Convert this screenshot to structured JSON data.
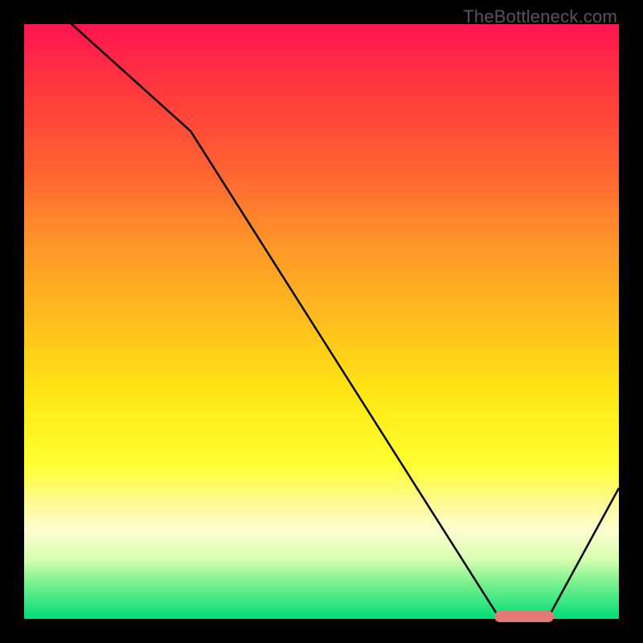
{
  "watermark": "TheBottleneck.com",
  "chart_data": {
    "type": "line",
    "title": "",
    "xlabel": "",
    "ylabel": "",
    "xlim": [
      0,
      100
    ],
    "ylim": [
      0,
      100
    ],
    "x": [
      0,
      8,
      28,
      80,
      88,
      100
    ],
    "values": [
      110,
      100,
      82,
      0,
      0,
      22
    ],
    "gradient_stops": [
      {
        "pct": 0,
        "color": "#ff1450"
      },
      {
        "pct": 25,
        "color": "#ff6432"
      },
      {
        "pct": 50,
        "color": "#ffbe1e"
      },
      {
        "pct": 74,
        "color": "#ffff32"
      },
      {
        "pct": 100,
        "color": "#00dc78"
      }
    ],
    "optimal_marker": {
      "x_start": 79,
      "x_end": 89,
      "y": 0,
      "color": "#e67878"
    }
  }
}
